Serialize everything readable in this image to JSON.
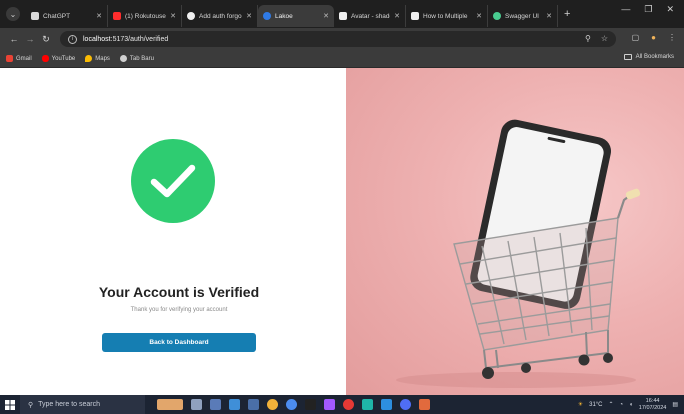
{
  "browser": {
    "tabs": [
      {
        "title": "ChatGPT",
        "favicon_color": "#d9d9d9",
        "active": false
      },
      {
        "title": "(1) Rokutousein",
        "favicon_color": "#ff2d2d",
        "active": false
      },
      {
        "title": "Add auth forgo",
        "favicon_color": "#f0f0f0",
        "active": false
      },
      {
        "title": "Lakoe",
        "favicon_color": "#2f7ae5",
        "active": true
      },
      {
        "title": "Avatar - shadcn",
        "favicon_color": "#f0f0f0",
        "active": false
      },
      {
        "title": "How to Multiple",
        "favicon_color": "#f0f0f0",
        "active": false
      },
      {
        "title": "Swagger UI",
        "favicon_color": "#49cc90",
        "active": false
      }
    ],
    "url_host": "localhost",
    "url_path": ":5173/auth/verified",
    "bookmarks": [
      {
        "label": "Gmail",
        "color": "#ea4335"
      },
      {
        "label": "YouTube",
        "color": "#ff0000"
      },
      {
        "label": "Maps",
        "color": "#fbbc04"
      },
      {
        "label": "Tab Baru",
        "color": "#d0d0d0"
      }
    ],
    "all_bookmarks_label": "All Bookmarks"
  },
  "page": {
    "title": "Your Account is Verified",
    "subtitle": "Thank you for verifying your account",
    "cta_label": "Back to Dashboard",
    "accent_color": "#157eb2",
    "success_color": "#2ecc71"
  },
  "taskbar": {
    "search_placeholder": "Type here to search",
    "temperature": "31°C",
    "time": "16:44",
    "date": "17/07/2024"
  }
}
